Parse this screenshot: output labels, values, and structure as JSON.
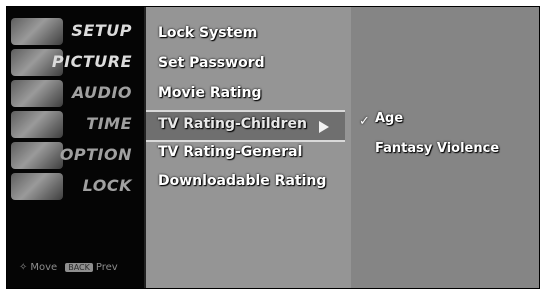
{
  "nav": {
    "items": [
      {
        "label": "SETUP",
        "icon": "setup-icon"
      },
      {
        "label": "PICTURE",
        "icon": "picture-icon"
      },
      {
        "label": "AUDIO",
        "icon": "audio-icon"
      },
      {
        "label": "TIME",
        "icon": "time-icon"
      },
      {
        "label": "OPTION",
        "icon": "option-icon"
      },
      {
        "label": "LOCK",
        "icon": "lock-icon"
      }
    ],
    "footer": {
      "move_label": "Move",
      "back_key": "BACK",
      "prev_label": "Prev"
    }
  },
  "menu": {
    "items": [
      {
        "label": "Lock System"
      },
      {
        "label": "Set Password"
      },
      {
        "label": "Movie Rating"
      },
      {
        "label": "TV Rating-Children",
        "selected": true
      },
      {
        "label": "TV Rating-General"
      },
      {
        "label": "Downloadable Rating"
      }
    ]
  },
  "submenu": {
    "items": [
      {
        "label": "Age",
        "checked": true
      },
      {
        "label": "Fantasy Violence",
        "checked": false
      }
    ]
  }
}
